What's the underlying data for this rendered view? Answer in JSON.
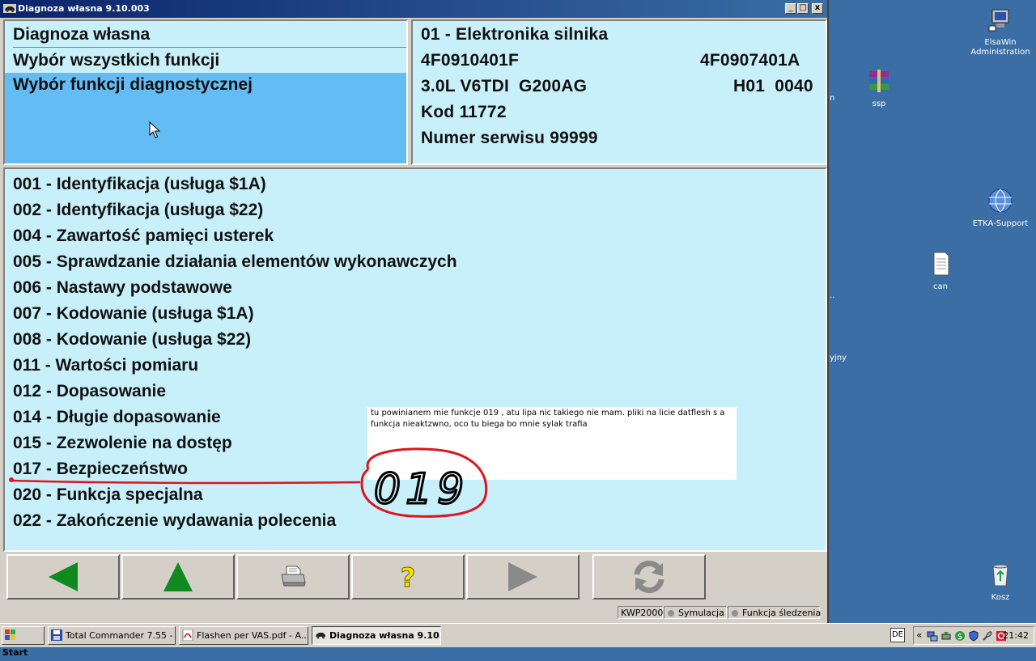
{
  "window": {
    "title": "Diagnoza własna 9.10.003",
    "controls": {
      "minimize": "_",
      "maximize": "□",
      "close": "x"
    }
  },
  "left_header": {
    "items": [
      "Diagnoza własna",
      "Wybór wszystkich funkcji",
      "Wybór funkcji diagnostycznej"
    ]
  },
  "right_header": {
    "line1": "01 - Elektronika silnika",
    "line2_left": "4F0910401F",
    "line2_right": "4F0907401A",
    "line3_left": "3.0L V6TDI  G200AG",
    "line3_right": "H01  0040",
    "line4": "Kod 11772",
    "line5": "Numer serwisu 99999"
  },
  "functions": [
    "001 - Identyfikacja (usługa $1A)",
    "002 - Identyfikacja (usługa $22)",
    "004 - Zawartość pamięci usterek",
    "005 - Sprawdzanie działania elementów wykonawczych",
    "006 - Nastawy podstawowe",
    "007 - Kodowanie (usługa $1A)",
    "008 - Kodowanie (usługa $22)",
    "011 - Wartości pomiaru",
    "012 - Dopasowanie",
    "014 - Długie dopasowanie",
    "015 - Zezwolenie na dostęp",
    "017 - Bezpieczeństwo",
    "020 - Funkcja specjalna",
    "022 - Zakończenie wydawania polecenia"
  ],
  "annotation": {
    "note": "tu powinianem mie funkcje 019 , atu lipa nic takiego nie mam. pliki na licie datflesh s a funkcja nieaktzwno, oco tu biega bo mnie sylak trafia",
    "handwritten": "019",
    "color": "#e0141c"
  },
  "toolbar": {
    "buttons": [
      "back-arrow-icon",
      "up-arrow-icon",
      "printer-icon",
      "help-icon",
      "forward-arrow-icon",
      "refresh-icon"
    ],
    "arrow_color": "#0f8a1e"
  },
  "status": {
    "protocol": "KWP2000",
    "simulation": "Symulacja",
    "trace": "Funkcja śledzenia"
  },
  "desktop_icons": [
    {
      "label": "ElsaWin Administration"
    },
    {
      "label": "ssp"
    },
    {
      "label": "ETKA-Support"
    },
    {
      "label": "can"
    },
    {
      "label": "Kosz"
    }
  ],
  "desktop_fragments": {
    "a": "n",
    "b": "..",
    "c": "yjny"
  },
  "taskbar": {
    "start": "Start",
    "tasks": [
      "Total Commander 7.55 - ...",
      "Flashen per VAS.pdf - A...",
      "Diagnoza własna 9.10..."
    ],
    "language": "DE",
    "tray_chevron": "«",
    "clock": "21:42"
  },
  "colors": {
    "panel": "#c8f0fa",
    "selected": "#63bcf3",
    "desktop": "#3a6ea5"
  }
}
